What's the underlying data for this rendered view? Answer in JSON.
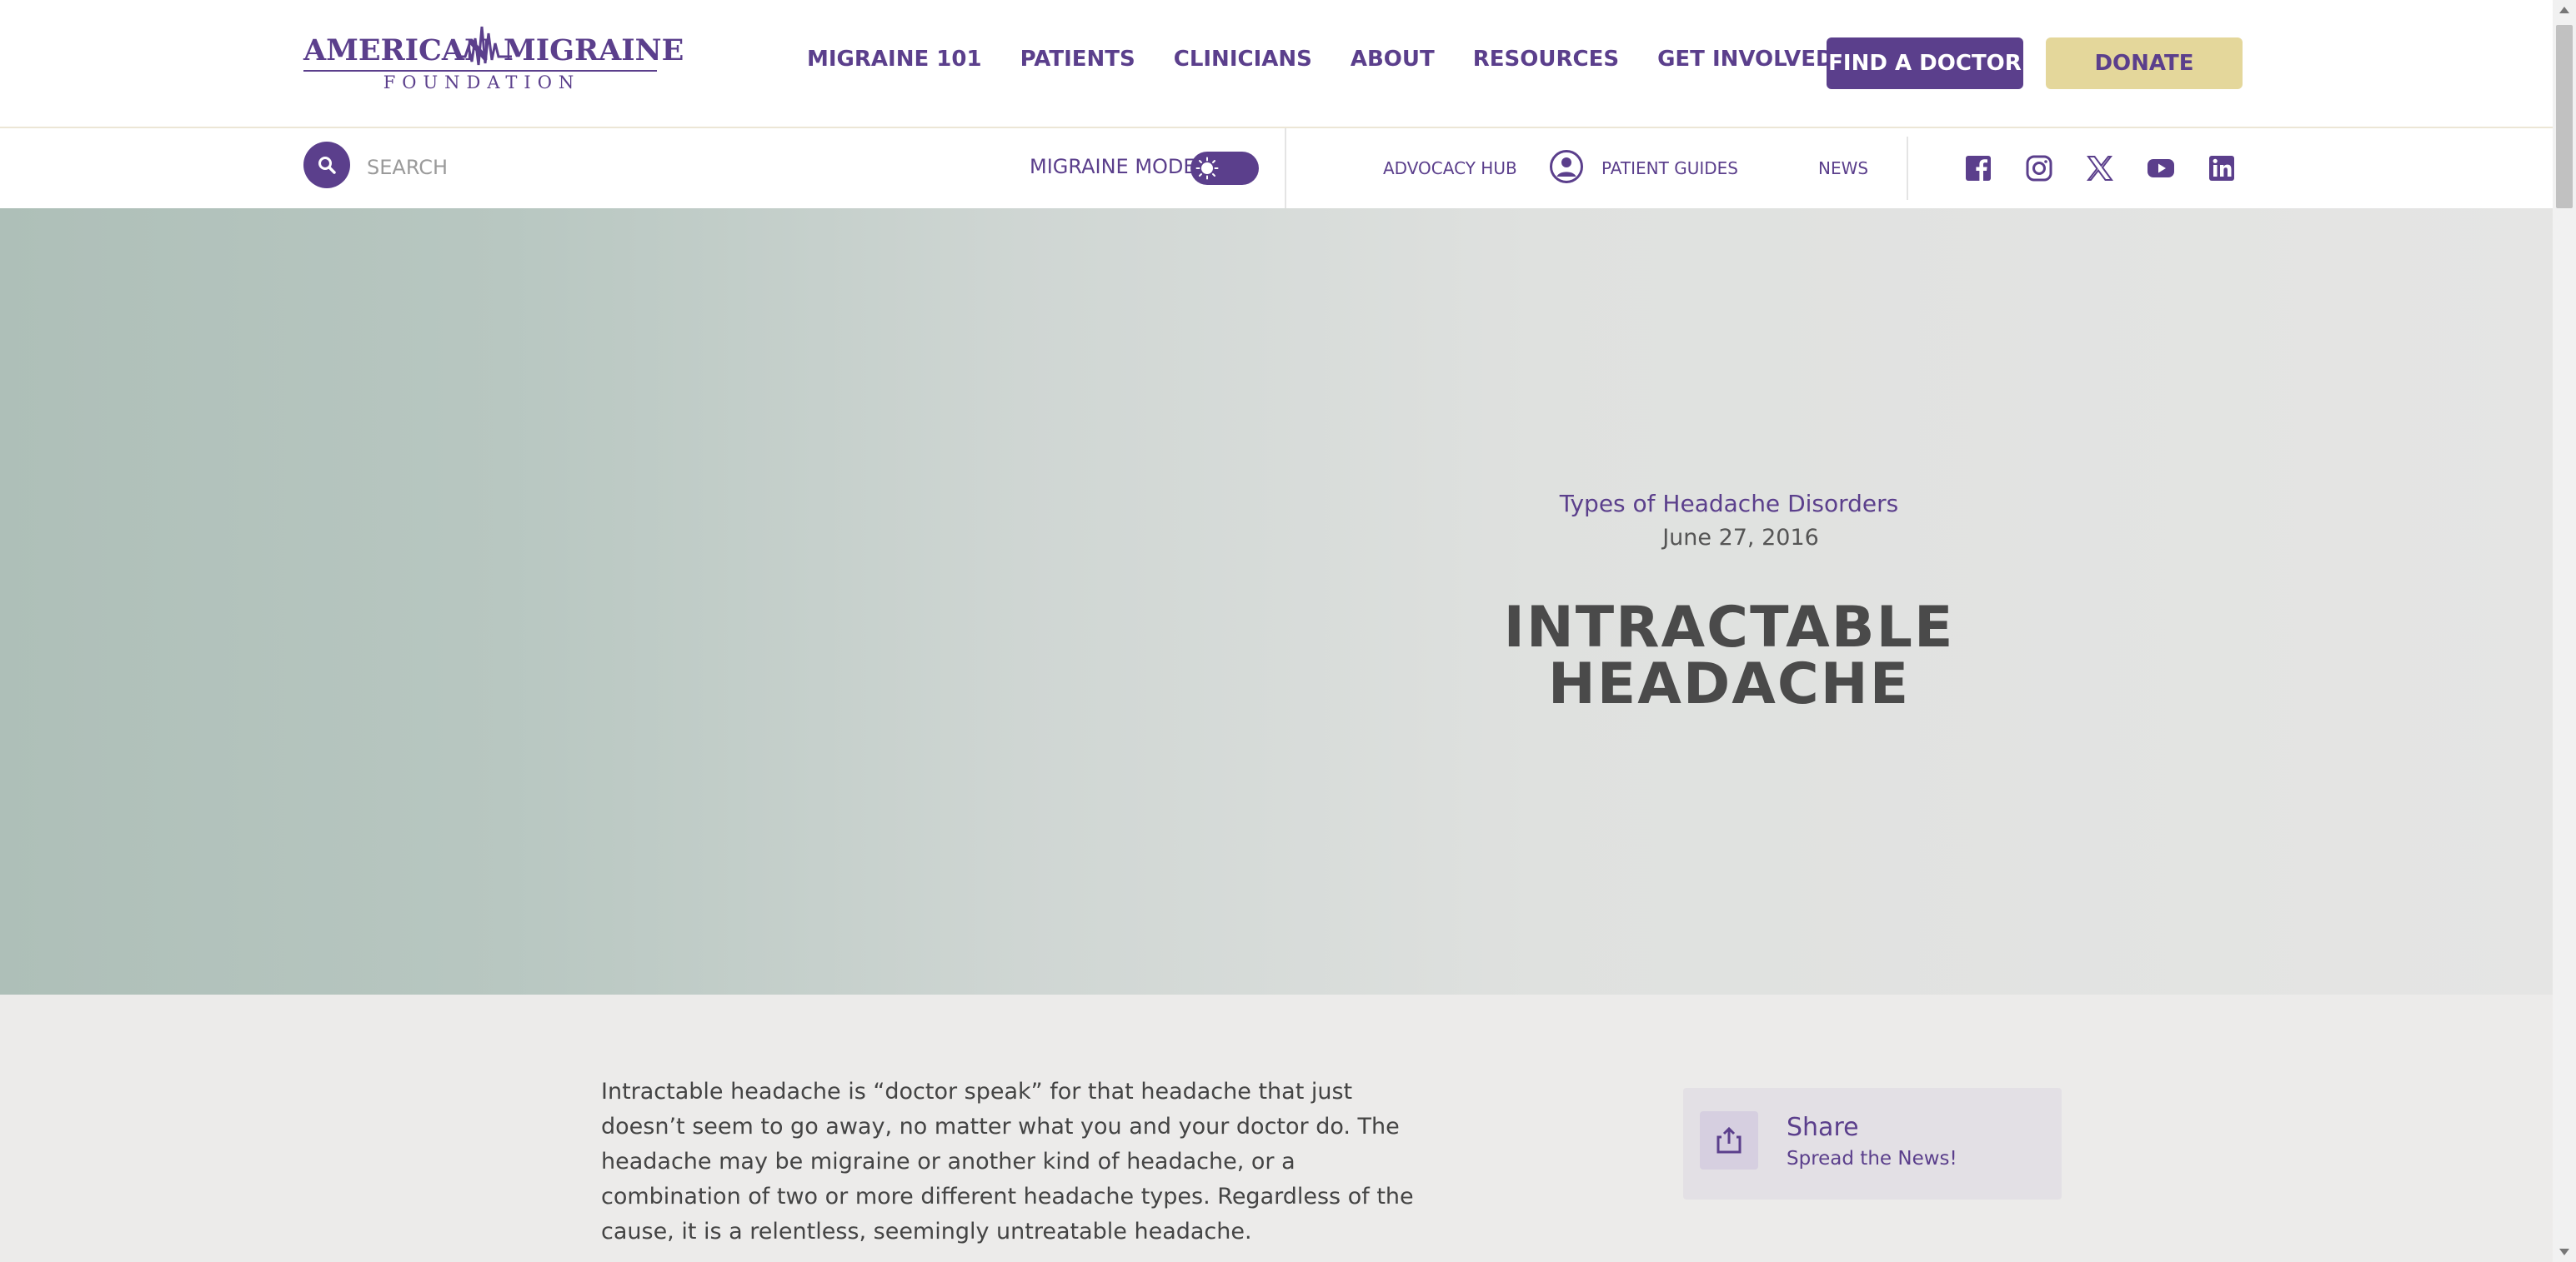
{
  "brand": {
    "logo_line1_left": "AMERICAN",
    "logo_line1_right": "MIGRAINE",
    "logo_line2": "FOUNDATION",
    "primary_color": "#5b3f8c",
    "accent_color": "#e4d79b"
  },
  "nav": {
    "items": [
      "MIGRAINE 101",
      "PATIENTS",
      "CLINICIANS",
      "ABOUT",
      "RESOURCES",
      "GET INVOLVED"
    ],
    "find_doctor": "FIND A DOCTOR",
    "donate": "DONATE"
  },
  "subbar": {
    "search_placeholder": "SEARCH",
    "migraine_mode_label": "MIGRAINE MODE",
    "advocacy_hub": "ADVOCACY HUB",
    "patient_guides": "PATIENT GUIDES",
    "news": "NEWS",
    "social_icons": [
      "facebook-icon",
      "instagram-icon",
      "x-icon",
      "youtube-icon",
      "linkedin-icon"
    ]
  },
  "hero": {
    "category": "Types of Headache Disorders",
    "date": "June 27, 2016",
    "title_line1": "INTRACTABLE",
    "title_line2": "HEADACHE"
  },
  "article": {
    "intro": "Intractable headache is “doctor speak” for that headache that just doesn’t seem to go away, no matter what you and your doctor do. The headache may be migraine or another kind of headache, or a combination of two or more different headache types. Regardless of the cause, it is a relentless, seemingly untreatable headache."
  },
  "share": {
    "title": "Share",
    "subtitle": "Spread the News!"
  }
}
